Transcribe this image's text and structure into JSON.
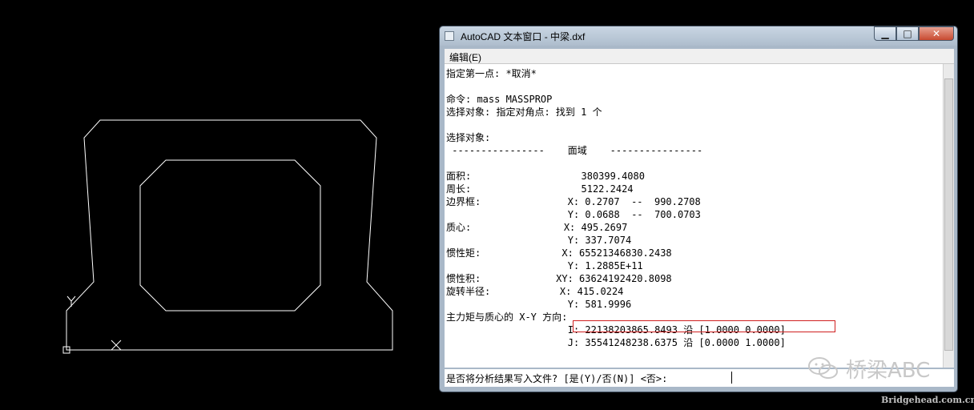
{
  "window": {
    "title": "AutoCAD 文本窗口 - 中梁.dxf",
    "minimize_glyph": "▁",
    "maximize_glyph": "□",
    "close_glyph": "✕",
    "menu": {
      "edit": "编辑(E)"
    }
  },
  "text_lines": [
    "指定第一点: *取消*",
    "",
    "命令: mass MASSPROP",
    "选择对象: 指定对角点: 找到 1 个",
    "",
    "选择对象:",
    " ----------------    面域    ----------------",
    "",
    "面积:                   380399.4080",
    "周长:                   5122.2424",
    "边界框:               X: 0.2707  --  990.2708",
    "                     Y: 0.0688  --  700.0703",
    "质心:                X: 495.2697",
    "                     Y: 337.7074",
    "惯性矩:              X: 65521346830.2438",
    "                     Y: 1.2885E+11",
    "惯性积:             XY: 63624192420.8098",
    "旋转半径:            X: 415.0224",
    "                     Y: 581.9996",
    "主力矩与质心的 X-Y 方向:",
    "                     I: 22138203865.8493 沿 [1.0000 0.0000]",
    "                     J: 35541248238.6375 沿 [0.0000 1.0000]"
  ],
  "command_prompt": "是否将分析结果写入文件? [是(Y)/否(N)] <否>: ",
  "watermark": {
    "title": "桥梁ABC",
    "url": "Bridgehead.com.cn"
  },
  "colors": {
    "background": "#000000",
    "drawing_line": "#ffffff",
    "highlight": "#d02020"
  }
}
